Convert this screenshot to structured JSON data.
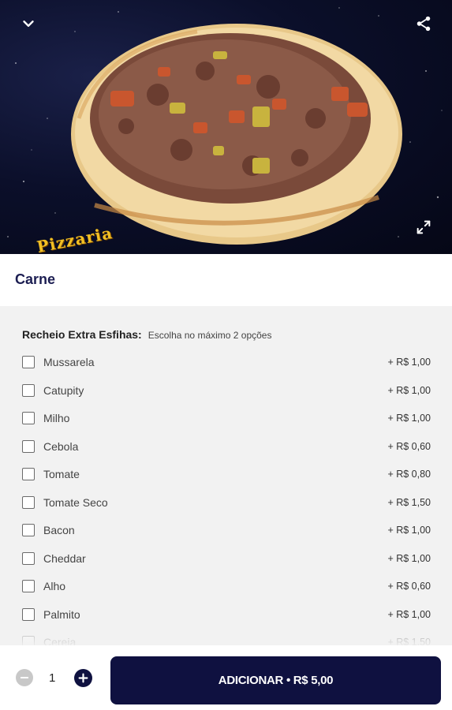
{
  "hero": {
    "back_icon": "chevron-down-icon",
    "share_icon": "share-icon",
    "expand_icon": "expand-icon",
    "logo_text": "Pizzaria"
  },
  "product": {
    "title": "Carne"
  },
  "extras": {
    "title": "Recheio Extra Esfihas:",
    "hint": "Escolha no máximo 2 opções",
    "items": [
      {
        "label": "Mussarela",
        "price": "+ R$ 1,00"
      },
      {
        "label": "Catupity",
        "price": "+ R$ 1,00"
      },
      {
        "label": "Milho",
        "price": "+ R$ 1,00"
      },
      {
        "label": "Cebola",
        "price": "+ R$ 0,60"
      },
      {
        "label": "Tomate",
        "price": "+ R$ 0,80"
      },
      {
        "label": "Tomate Seco",
        "price": "+ R$ 1,50"
      },
      {
        "label": "Bacon",
        "price": "+ R$ 1,00"
      },
      {
        "label": "Cheddar",
        "price": "+ R$ 1,00"
      },
      {
        "label": "Alho",
        "price": "+ R$ 0,60"
      },
      {
        "label": "Palmito",
        "price": "+ R$ 1,00"
      },
      {
        "label": "Cereja",
        "price": "+ R$ 1,50"
      }
    ]
  },
  "footer": {
    "quantity": "1",
    "add_label": "ADICIONAR • R$ 5,00"
  },
  "colors": {
    "brand": "#0f1140",
    "title": "#1c1e52",
    "panel": "#f2f2f2"
  }
}
